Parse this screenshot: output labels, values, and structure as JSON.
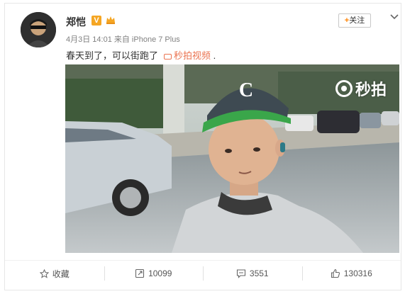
{
  "post": {
    "username": "郑恺",
    "verified_badge": "V",
    "meta": "4月3日 14:01 来自 iPhone 7 Plus",
    "text": "春天到了，可以街跑了",
    "video_link_label": "秒拍视频",
    "trailing_period": "."
  },
  "header": {
    "follow_plus": "+",
    "follow_label": "关注"
  },
  "video": {
    "watermark": "秒拍",
    "cap_logo": "C"
  },
  "actions": [
    {
      "icon": "star-icon",
      "label": "收藏"
    },
    {
      "icon": "repost-icon",
      "label": "10099"
    },
    {
      "icon": "comment-icon",
      "label": "3551"
    },
    {
      "icon": "like-icon",
      "label": "130316"
    }
  ],
  "colors": {
    "accent_orange": "#ff8200",
    "link": "#eb7350",
    "cap_brim": "#3aa64a",
    "badge": "#f5a623"
  }
}
